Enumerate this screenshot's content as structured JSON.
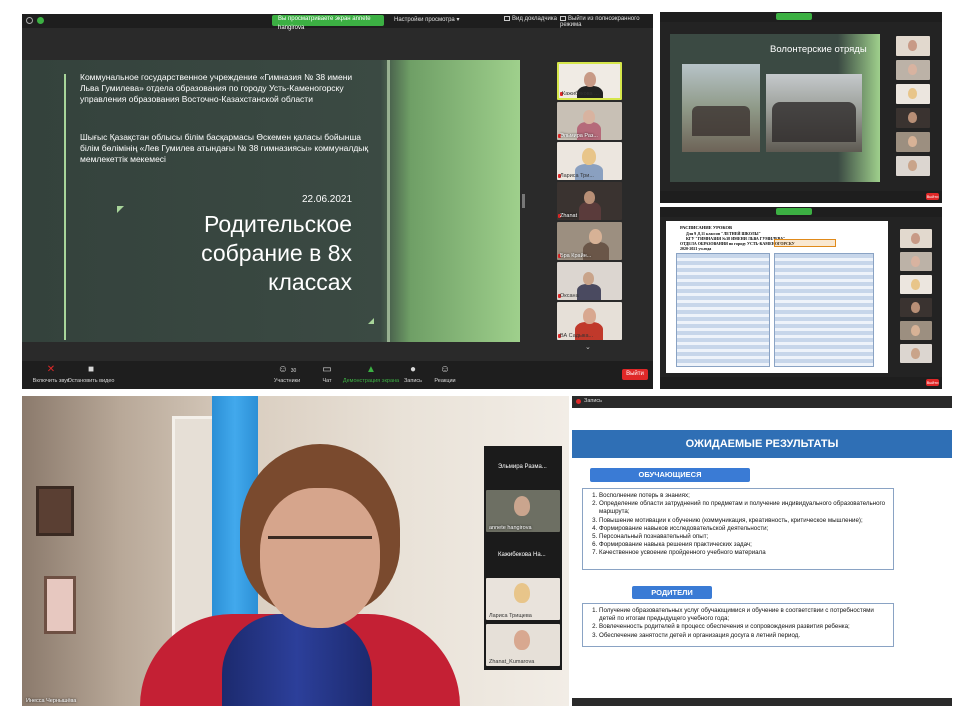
{
  "p1": {
    "green_banner": "Вы просматриваете экран annete hangirova",
    "view_settings": "Настройки просмотра",
    "view_settings_caret": "▾",
    "dual_view": "Вид докладчика",
    "exit_fullscreen": "Выйти из полноэкранного режима",
    "slide": {
      "org_ru": "Коммунальное государственное учреждение «Гимназия № 38 имени Льва Гумилева» отдела образования по городу Усть-Каменогорску управления образования Восточно-Казахстанской области",
      "org_kz": "Шығыс Қазақстан облысы білім басқармасы Өскемен қаласы бойынша білім бөлімінің «Лев Гумилев атындағы № 38 гимназиясы» коммуналдық мемлекеттік мекемесі",
      "date": "22.06.2021",
      "title": "Родительское собрание в 8х классах"
    },
    "participants": [
      {
        "name": "Кажибекова ..."
      },
      {
        "name": "Эльмира Раз..."
      },
      {
        "name": "Лариса Три..."
      },
      {
        "name": "Zhanat"
      },
      {
        "name": "Бра Крайн..."
      },
      {
        "name": "Оксана"
      },
      {
        "name": "ВА Садыка..."
      }
    ],
    "toolbar": {
      "mute": "Включить звук",
      "video": "Остановить видео",
      "participants": "Участники",
      "participants_count": "30",
      "chat": "Чат",
      "share": "Демонстрация экрана",
      "record": "Запись",
      "reactions": "Реакции",
      "end": "Выйти"
    }
  },
  "p2": {
    "title": "Волонтерские отряды",
    "end": "Выйти"
  },
  "p3": {
    "doc_header": "РАСПИСАНИЕ УРОКОВ",
    "doc_sub1": "Для 9 ,8,11 классов \"ЛЕТНЕЙ ШКОЛЫ\"",
    "doc_sub2": "КГУ \"ГИМНАЗИЯ №38 ИМЕНИ ЛЬВА ГУМИЛЕВА\"",
    "doc_sub3": "ОТДЕЛА ОБРАЗОВАНИЯ по городу УСТЬ-КАМЕНОГОРСКУ",
    "doc_sub4": "2020-2021 уч.года",
    "end": "Выйти"
  },
  "p4": {
    "name1": "Эльмира Разма...",
    "name2": "annete hangirova",
    "name3": "Кажибекова На...",
    "name4": "Лариса Трищева",
    "name5": "Zhanat_Kumarova",
    "self_name": "Инесса Чернышёва"
  },
  "p5": {
    "rec_label": "Запись",
    "title": "ОЖИДАЕМЫЕ РЕЗУЛЬТАТЫ",
    "students_label": "ОБУЧАЮЩИЕСЯ",
    "students_items": [
      "Восполнение потерь в знаниях;",
      "Определение области затруднений по предметам и получение индивидуального образовательного маршрута;",
      "Повышение мотивации к обучению (коммуникация, креативность, критическое мышление);",
      "Формирование навыков исследовательской деятельности;",
      "Персональный познавательный опыт;",
      "Формирование навыка решения практических задач;",
      "Качественное усвоение пройденного учебного материала"
    ],
    "parents_label": "РОДИТЕЛИ",
    "parents_items": [
      "Получение образовательных услуг обучающимися и обучение в соответствии с потребностями детей по итогам предыдущего учебного года;",
      "Вовлеченность родителей в процесс обеспечения и сопровождения развития ребенка;",
      "Обеспечение занятости детей и организация досуга в летний период."
    ]
  },
  "colors": {
    "zoom_green": "#3cb043",
    "end_red": "#e02828",
    "slide_dark": "#3b4a43",
    "slide_green": "#9fd08c",
    "blue_header": "#2f6fb5",
    "blue_label": "#3a7bd5"
  }
}
